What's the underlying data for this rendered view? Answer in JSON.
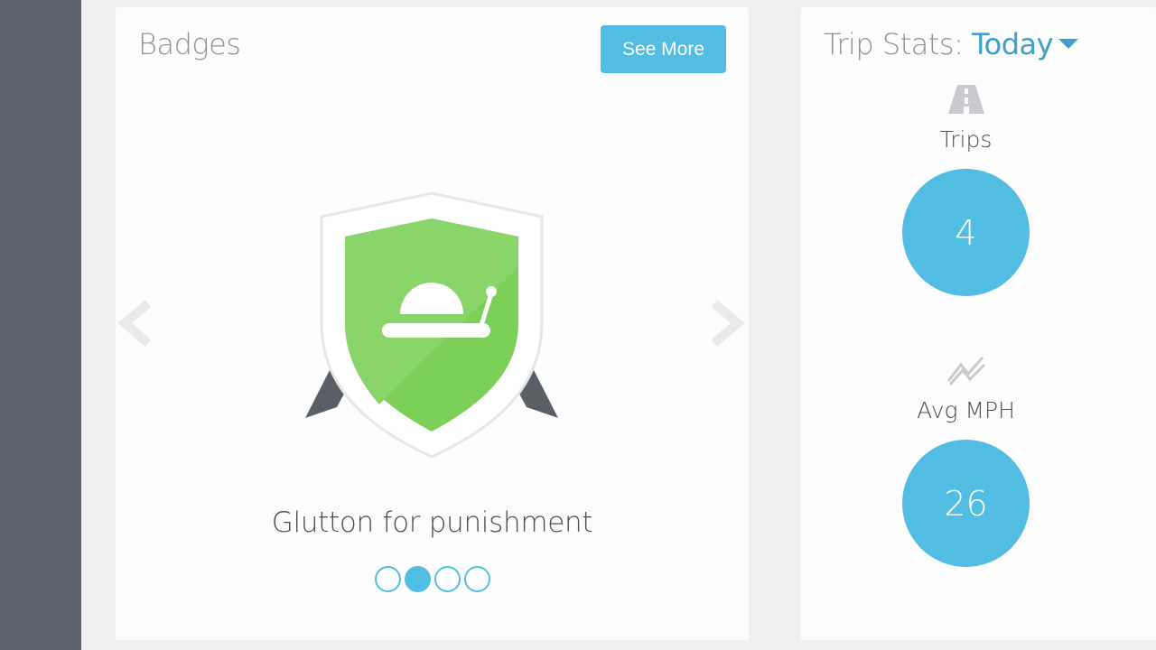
{
  "badges": {
    "title": "Badges",
    "see_more_label": "See More",
    "current_badge_name": "Glutton for punishment",
    "badge_icon": "snail-icon",
    "pagination": {
      "count": 4,
      "active_index": 1
    }
  },
  "trip_stats": {
    "title": "Trip Stats: ",
    "period": "Today",
    "stats": [
      {
        "icon": "road-icon",
        "label": "Trips",
        "value": "4"
      },
      {
        "icon": "trend-icon",
        "label": "Avg MPH",
        "value": "26"
      }
    ]
  },
  "colors": {
    "accent": "#52bde3",
    "shield_green": "#7ccf57",
    "sidebar": "#5e646d",
    "ribbon": "#5a5f66"
  }
}
